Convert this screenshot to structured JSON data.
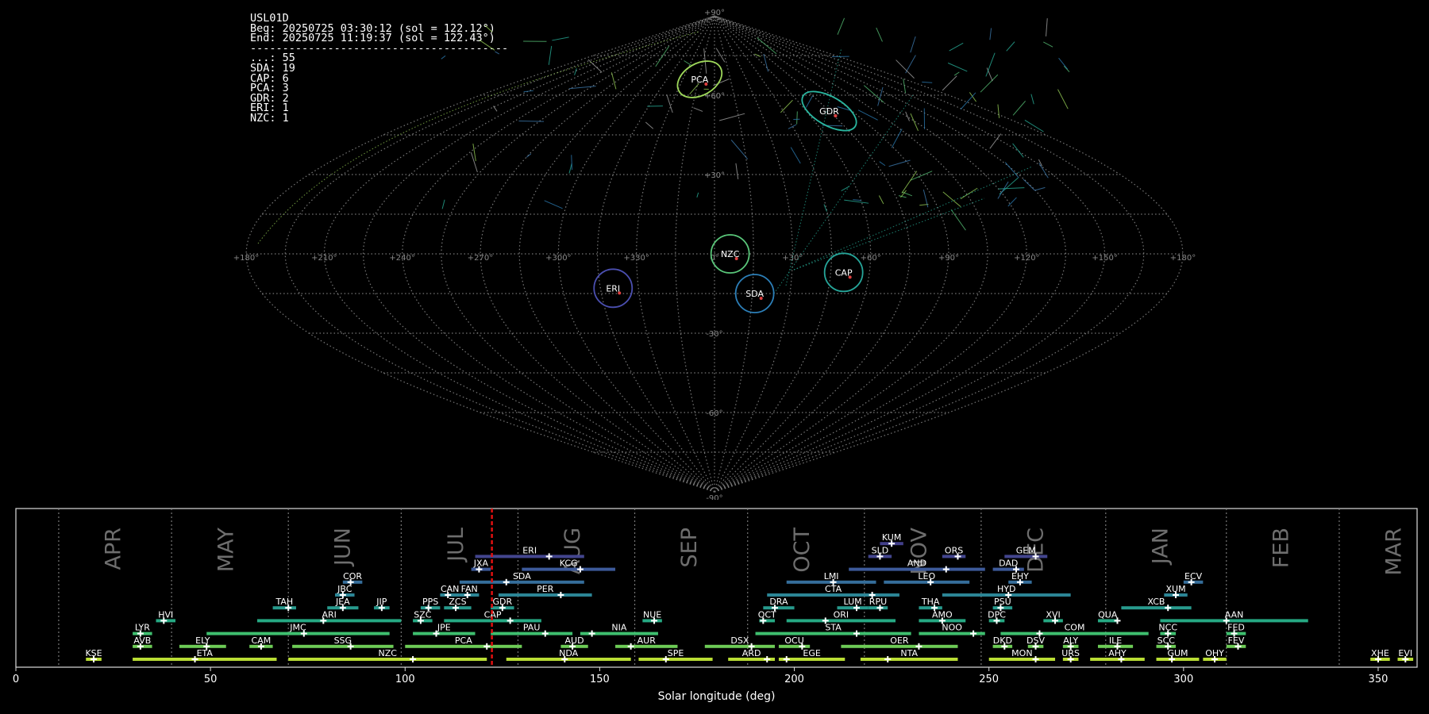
{
  "info": {
    "station": "USL01D",
    "begin": "Beg: 20250725 03:30:12 (sol = 122.12°)",
    "end": "End: 20250725 11:19:37 (sol = 122.43°)",
    "separator": "----------------------------------------",
    "counts": [
      {
        "code": "...",
        "n": 55
      },
      {
        "code": "SDA",
        "n": 19
      },
      {
        "code": "CAP",
        "n": 6
      },
      {
        "code": "PCA",
        "n": 3
      },
      {
        "code": "GDR",
        "n": 2
      },
      {
        "code": "ERI",
        "n": 1
      },
      {
        "code": "NZC",
        "n": 1
      }
    ]
  },
  "chart_data": [
    {
      "type": "scatter",
      "projection": "sinusoidal sky map",
      "lat_labels": [
        "+90°",
        "+60°",
        "+30°",
        "0°",
        "-30°",
        "-60°",
        "-90°"
      ],
      "lon_labels": [
        "+180°",
        "+150°",
        "+120°",
        "+90°",
        "+60°",
        "+30°",
        "0°",
        "+330°",
        "+300°",
        "+270°",
        "+240°",
        "+210°",
        "+180°"
      ],
      "radiants": [
        {
          "code": "PCA",
          "lon": 14,
          "lat": 66,
          "color": "#9ed85a"
        },
        {
          "code": "GDR",
          "lon": 285,
          "lat": 54,
          "color": "#2ab7a0"
        },
        {
          "code": "NZC",
          "lon": 354,
          "lat": 0,
          "color": "#5ac77a"
        },
        {
          "code": "CAP",
          "lon": 310,
          "lat": -7,
          "color": "#26a69a"
        },
        {
          "code": "SDA",
          "lon": 344,
          "lat": -15,
          "color": "#2c7fb8"
        },
        {
          "code": "ERI",
          "lon": 40,
          "lat": -13,
          "color": "#4b4fb0"
        }
      ]
    },
    {
      "type": "timeline",
      "xlabel": "Solar longitude (deg)",
      "xlim": [
        0,
        360
      ],
      "xticks": [
        0,
        50,
        100,
        150,
        200,
        250,
        300,
        350
      ],
      "marker": 122.3,
      "months": [
        {
          "name": "APR",
          "sol": 11
        },
        {
          "name": "MAY",
          "sol": 40
        },
        {
          "name": "JUN",
          "sol": 70
        },
        {
          "name": "JUL",
          "sol": 99
        },
        {
          "name": "AUG",
          "sol": 129
        },
        {
          "name": "SEP",
          "sol": 159
        },
        {
          "name": "OCT",
          "sol": 188
        },
        {
          "name": "NOV",
          "sol": 218
        },
        {
          "name": "DEC",
          "sol": 248
        },
        {
          "name": "JAN",
          "sol": 280
        },
        {
          "name": "FEB",
          "sol": 311
        },
        {
          "name": "MAR",
          "sol": 340
        }
      ],
      "showers": [
        {
          "code": "KUM",
          "start": 222,
          "end": 228,
          "peak": 225,
          "row": 11
        },
        {
          "code": "ERI",
          "start": 118,
          "end": 146,
          "peak": 137,
          "row": 10
        },
        {
          "code": "SLD",
          "start": 219,
          "end": 225,
          "peak": 222,
          "row": 10
        },
        {
          "code": "ORS",
          "start": 238,
          "end": 244,
          "peak": 242,
          "row": 10
        },
        {
          "code": "GEM",
          "start": 254,
          "end": 265,
          "peak": 262,
          "row": 10
        },
        {
          "code": "JXA",
          "start": 117,
          "end": 122,
          "peak": 119,
          "row": 9
        },
        {
          "code": "KCG",
          "start": 130,
          "end": 154,
          "peak": 145,
          "row": 9
        },
        {
          "code": "AND",
          "start": 214,
          "end": 249,
          "peak": 239,
          "row": 9
        },
        {
          "code": "DAD",
          "start": 251,
          "end": 259,
          "peak": 257,
          "row": 9
        },
        {
          "code": "COR",
          "start": 84,
          "end": 89,
          "peak": 86,
          "row": 8
        },
        {
          "code": "SDA",
          "start": 114,
          "end": 146,
          "peak": 126,
          "row": 8
        },
        {
          "code": "LMI",
          "start": 198,
          "end": 221,
          "peak": 210,
          "row": 8
        },
        {
          "code": "LEO",
          "start": 223,
          "end": 245,
          "peak": 235,
          "row": 8
        },
        {
          "code": "EHY",
          "start": 255,
          "end": 261,
          "peak": 258,
          "row": 8
        },
        {
          "code": "ECV",
          "start": 300,
          "end": 305,
          "peak": 302,
          "row": 8
        },
        {
          "code": "JBC",
          "start": 82,
          "end": 87,
          "peak": 84,
          "row": 7
        },
        {
          "code": "CAN",
          "start": 109,
          "end": 114,
          "peak": 111,
          "row": 7
        },
        {
          "code": "FAN",
          "start": 114,
          "end": 119,
          "peak": 116,
          "row": 7
        },
        {
          "code": "PER",
          "start": 124,
          "end": 148,
          "peak": 140,
          "row": 7
        },
        {
          "code": "CTA",
          "start": 193,
          "end": 227,
          "peak": 220,
          "row": 7
        },
        {
          "code": "HYD",
          "start": 238,
          "end": 271,
          "peak": 255,
          "row": 7
        },
        {
          "code": "XUM",
          "start": 295,
          "end": 301,
          "peak": 298,
          "row": 7
        },
        {
          "code": "TAH",
          "start": 66,
          "end": 72,
          "peak": 70,
          "row": 6
        },
        {
          "code": "JEA",
          "start": 80,
          "end": 88,
          "peak": 84,
          "row": 6
        },
        {
          "code": "JIP",
          "start": 92,
          "end": 96,
          "peak": 94,
          "row": 6
        },
        {
          "code": "PPS",
          "start": 104,
          "end": 109,
          "peak": 106,
          "row": 6
        },
        {
          "code": "ZCS",
          "start": 110,
          "end": 117,
          "peak": 113,
          "row": 6
        },
        {
          "code": "GDR",
          "start": 122,
          "end": 128,
          "peak": 125,
          "row": 6
        },
        {
          "code": "DRA",
          "start": 192,
          "end": 200,
          "peak": 195,
          "row": 6
        },
        {
          "code": "LUM",
          "start": 211,
          "end": 219,
          "peak": 216,
          "row": 6
        },
        {
          "code": "RPU",
          "start": 219,
          "end": 224,
          "peak": 222,
          "row": 6
        },
        {
          "code": "THA",
          "start": 232,
          "end": 238,
          "peak": 236,
          "row": 6
        },
        {
          "code": "PSU",
          "start": 251,
          "end": 256,
          "peak": 253,
          "row": 6
        },
        {
          "code": "XCB",
          "start": 284,
          "end": 302,
          "peak": 296,
          "row": 6
        },
        {
          "code": "HVI",
          "start": 36,
          "end": 41,
          "peak": 38,
          "row": 5
        },
        {
          "code": "ARI",
          "start": 62,
          "end": 99,
          "peak": 79,
          "row": 5
        },
        {
          "code": "SZC",
          "start": 102,
          "end": 107,
          "peak": 104,
          "row": 5
        },
        {
          "code": "CAP",
          "start": 110,
          "end": 135,
          "peak": 127,
          "row": 5
        },
        {
          "code": "NUE",
          "start": 161,
          "end": 166,
          "peak": 164,
          "row": 5
        },
        {
          "code": "OCT",
          "start": 191,
          "end": 195,
          "peak": 192,
          "row": 5
        },
        {
          "code": "ORI",
          "start": 198,
          "end": 226,
          "peak": 208,
          "row": 5
        },
        {
          "code": "AMO",
          "start": 232,
          "end": 244,
          "peak": 238,
          "row": 5
        },
        {
          "code": "DPC",
          "start": 250,
          "end": 254,
          "peak": 252,
          "row": 5
        },
        {
          "code": "XVI",
          "start": 264,
          "end": 269,
          "peak": 267,
          "row": 5
        },
        {
          "code": "QUA",
          "start": 278,
          "end": 283,
          "peak": 283,
          "row": 5
        },
        {
          "code": "AAN",
          "start": 294,
          "end": 332,
          "peak": 311,
          "row": 5
        },
        {
          "code": "LYR",
          "start": 30,
          "end": 35,
          "peak": 32,
          "row": 4
        },
        {
          "code": "JMC",
          "start": 49,
          "end": 96,
          "peak": 74,
          "row": 4
        },
        {
          "code": "JPE",
          "start": 102,
          "end": 118,
          "peak": 108,
          "row": 4
        },
        {
          "code": "PAU",
          "start": 122,
          "end": 143,
          "peak": 136,
          "row": 4
        },
        {
          "code": "NIA",
          "start": 145,
          "end": 165,
          "peak": 148,
          "row": 4
        },
        {
          "code": "STA",
          "start": 190,
          "end": 230,
          "peak": 216,
          "row": 4
        },
        {
          "code": "NOO",
          "start": 232,
          "end": 249,
          "peak": 246,
          "row": 4
        },
        {
          "code": "COM",
          "start": 253,
          "end": 291,
          "peak": 263,
          "row": 4
        },
        {
          "code": "NCC",
          "start": 294,
          "end": 298,
          "peak": 296,
          "row": 4
        },
        {
          "code": "FED",
          "start": 311,
          "end": 316,
          "peak": 313,
          "row": 4
        },
        {
          "code": "AVB",
          "start": 30,
          "end": 35,
          "peak": 32,
          "row": 3
        },
        {
          "code": "ELY",
          "start": 42,
          "end": 54,
          "peak": 49,
          "row": 3
        },
        {
          "code": "CAM",
          "start": 60,
          "end": 66,
          "peak": 63,
          "row": 3
        },
        {
          "code": "SSG",
          "start": 71,
          "end": 97,
          "peak": 86,
          "row": 3
        },
        {
          "code": "PCA",
          "start": 100,
          "end": 130,
          "peak": 121,
          "row": 3
        },
        {
          "code": "AUD",
          "start": 140,
          "end": 147,
          "peak": 143,
          "row": 3
        },
        {
          "code": "AUR",
          "start": 154,
          "end": 170,
          "peak": 158,
          "row": 3
        },
        {
          "code": "DSX",
          "start": 177,
          "end": 195,
          "peak": 189,
          "row": 3
        },
        {
          "code": "OCU",
          "start": 196,
          "end": 204,
          "peak": 202,
          "row": 3
        },
        {
          "code": "OER",
          "start": 212,
          "end": 242,
          "peak": 232,
          "row": 3
        },
        {
          "code": "DKD",
          "start": 251,
          "end": 256,
          "peak": 254,
          "row": 3
        },
        {
          "code": "DSV",
          "start": 260,
          "end": 264,
          "peak": 262,
          "row": 3
        },
        {
          "code": "ALY",
          "start": 269,
          "end": 273,
          "peak": 271,
          "row": 3
        },
        {
          "code": "ILE",
          "start": 278,
          "end": 287,
          "peak": 283,
          "row": 3
        },
        {
          "code": "SCC",
          "start": 293,
          "end": 298,
          "peak": 296,
          "row": 3
        },
        {
          "code": "FEV",
          "start": 311,
          "end": 316,
          "peak": 314,
          "row": 3
        },
        {
          "code": "KSE",
          "start": 18,
          "end": 22,
          "peak": 20,
          "row": 2
        },
        {
          "code": "ETA",
          "start": 30,
          "end": 67,
          "peak": 46,
          "row": 2
        },
        {
          "code": "NZC",
          "start": 70,
          "end": 121,
          "peak": 102,
          "row": 2
        },
        {
          "code": "NDA",
          "start": 126,
          "end": 158,
          "peak": 141,
          "row": 2
        },
        {
          "code": "SPE",
          "start": 160,
          "end": 179,
          "peak": 167,
          "row": 2
        },
        {
          "code": "ARD",
          "start": 183,
          "end": 195,
          "peak": 193,
          "row": 2
        },
        {
          "code": "EGE",
          "start": 196,
          "end": 213,
          "peak": 198,
          "row": 2
        },
        {
          "code": "NTA",
          "start": 217,
          "end": 242,
          "peak": 224,
          "row": 2
        },
        {
          "code": "MON",
          "start": 250,
          "end": 267,
          "peak": 262,
          "row": 2
        },
        {
          "code": "URS",
          "start": 269,
          "end": 273,
          "peak": 271,
          "row": 2
        },
        {
          "code": "AHY",
          "start": 276,
          "end": 290,
          "peak": 284,
          "row": 2
        },
        {
          "code": "GUM",
          "start": 293,
          "end": 304,
          "peak": 297,
          "row": 2
        },
        {
          "code": "OHY",
          "start": 305,
          "end": 311,
          "peak": 308,
          "row": 2
        },
        {
          "code": "XHE",
          "start": 348,
          "end": 353,
          "peak": 350,
          "row": 2
        },
        {
          "code": "EVI",
          "start": 355,
          "end": 359,
          "peak": 357,
          "row": 2
        }
      ]
    }
  ]
}
